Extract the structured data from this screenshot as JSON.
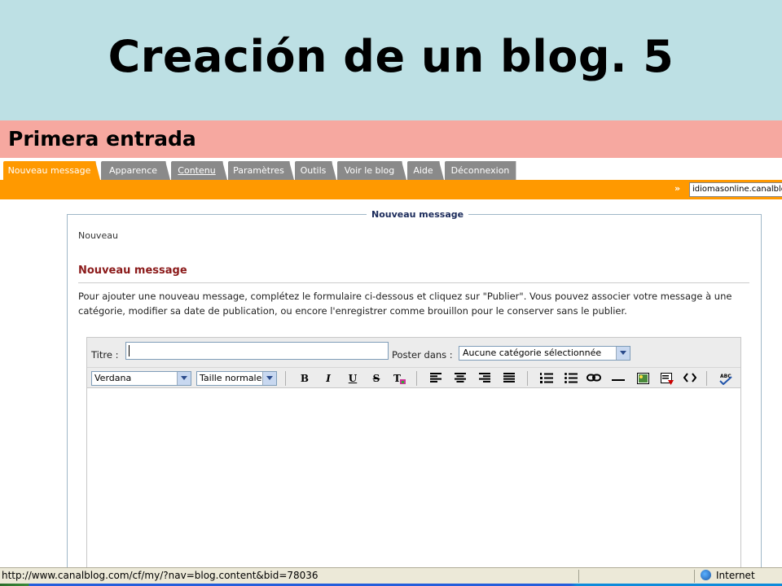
{
  "slide": {
    "title": "Creación de un blog. 5",
    "subtitle": "Primera entrada"
  },
  "tabs": [
    {
      "label": "Nouveau message",
      "active": true
    },
    {
      "label": "Apparence"
    },
    {
      "label": "Contenu",
      "underlined": true
    },
    {
      "label": "Paramètres"
    },
    {
      "label": "Outils"
    },
    {
      "label": "Voir le blog"
    },
    {
      "label": "Aide"
    },
    {
      "label": "Déconnexion"
    }
  ],
  "blog_switch": {
    "arrows": "»",
    "selected": "idiomasonline.canalblog.com"
  },
  "panel": {
    "legend": "Nouveau message",
    "breadcrumb": "Nouveau",
    "heading": "Nouveau message",
    "intro": "Pour ajouter une nouveau message, complétez le formulaire ci-dessous et cliquez sur \"Publier\". Vous pouvez associer votre message à une catégorie, modifier sa date de publication, ou encore l'enregistrer comme brouillon pour le conserver sans le publier."
  },
  "form": {
    "title_label": "Titre :",
    "title_value": "",
    "category_label": "Poster dans :",
    "category_value": "Aucune catégorie sélectionnée"
  },
  "toolbar": {
    "font_value": "Verdana",
    "size_value": "Taille normale",
    "bold": "B",
    "italic": "I",
    "underline": "U",
    "strike": "S",
    "clear_format": "T"
  },
  "statusbar": {
    "url": "http://www.canalblog.com/cf/my/?nav=blog.content&bid=78036",
    "zone": "Internet"
  },
  "colors": {
    "title_band": "#bde0e4",
    "subtitle_band": "#f6a8a0",
    "accent_orange": "#ff9900",
    "tab_gray": "#8a8a8a",
    "heading_red": "#8b1a1a"
  }
}
